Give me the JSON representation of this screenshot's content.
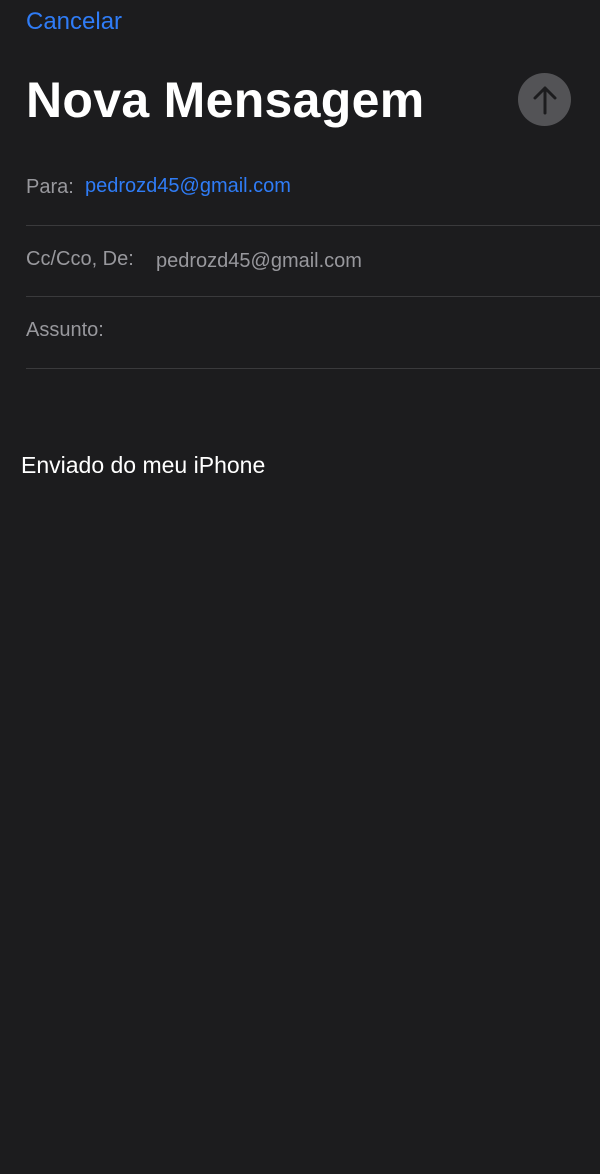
{
  "header": {
    "cancel_label": "Cancelar",
    "title": "Nova Mensagem",
    "send_icon": "arrow-up-icon"
  },
  "fields": {
    "to": {
      "label": "Para:",
      "value": "pedrozd45@gmail.com"
    },
    "cc_from": {
      "label": "Cc/Cco, De:",
      "value": "pedrozd45@gmail.com"
    },
    "subject": {
      "label": "Assunto:",
      "value": ""
    }
  },
  "body": {
    "signature": "Enviado do meu iPhone"
  },
  "colors": {
    "background": "#1c1c1e",
    "accent": "#2f7cf6",
    "secondary_text": "#98989d",
    "send_button_disabled": "#535356",
    "separator": "#3a3a3c"
  }
}
